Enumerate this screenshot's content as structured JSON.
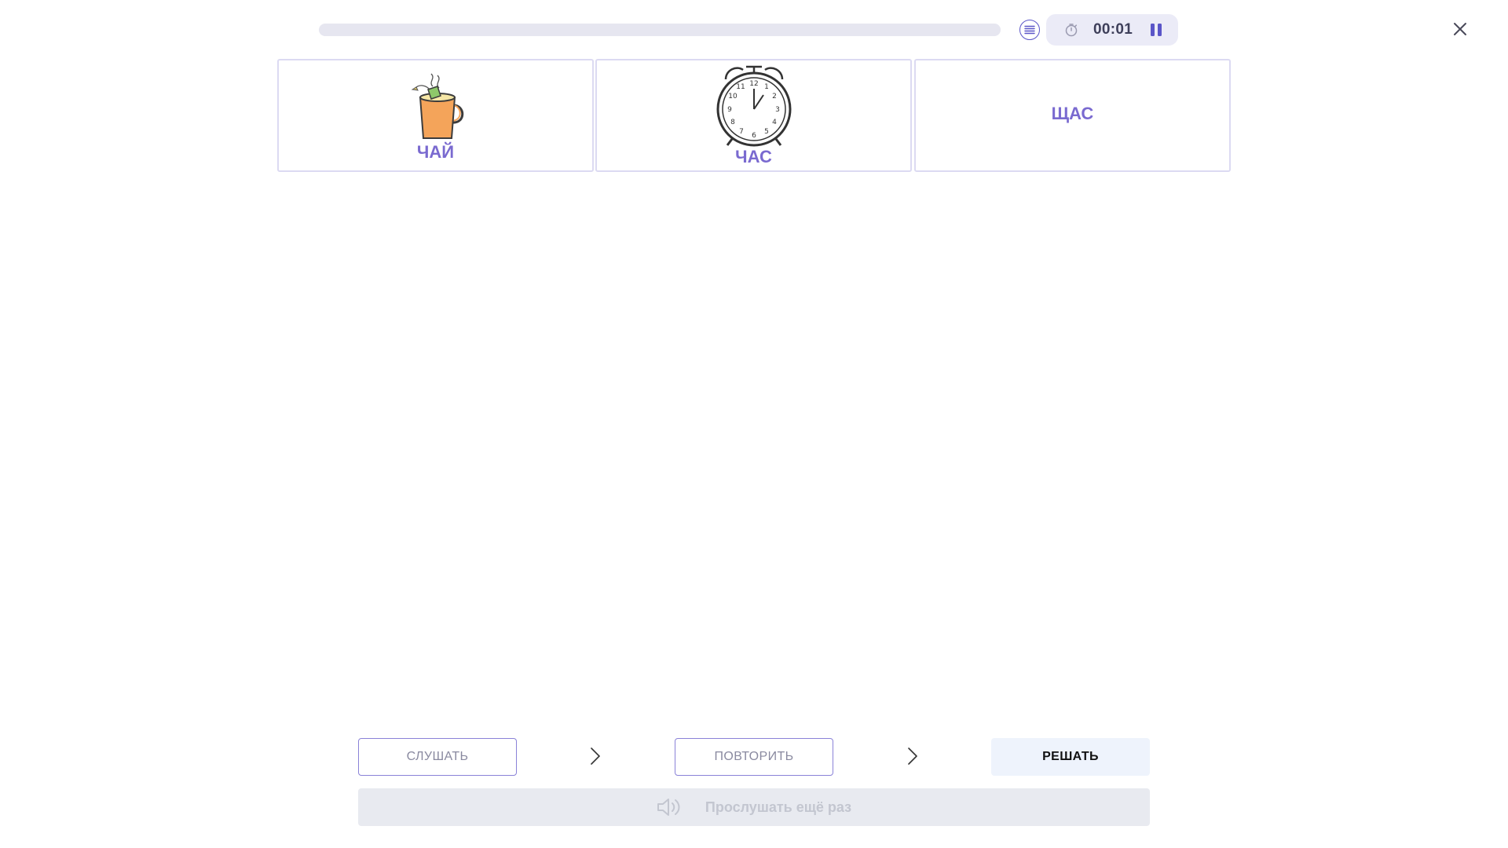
{
  "header": {
    "progress": 0,
    "timer": "00:01",
    "icons": {
      "list": "list-icon",
      "stopwatch": "stopwatch-icon",
      "pause": "pause-icon",
      "close": "close-icon"
    }
  },
  "cards": [
    {
      "word": "ЧАЙ",
      "picture": "tea-mug-icon"
    },
    {
      "word": "ЧАС",
      "picture": "alarm-clock-icon"
    },
    {
      "word": "ЩАС",
      "picture": ""
    }
  ],
  "steps": [
    {
      "label": "СЛУШАТЬ"
    },
    {
      "label": "ПОВТОРИТЬ"
    },
    {
      "label": "РЕШАТЬ"
    }
  ],
  "listen_again": {
    "label": "Прослушать ещё раз",
    "icon": "speaker-icon"
  },
  "colors": {
    "accent": "#7a6ad0",
    "card_border": "#dcdaf2",
    "timer_bg": "#ebebf7",
    "disabled_bg": "#e8eaf0"
  }
}
